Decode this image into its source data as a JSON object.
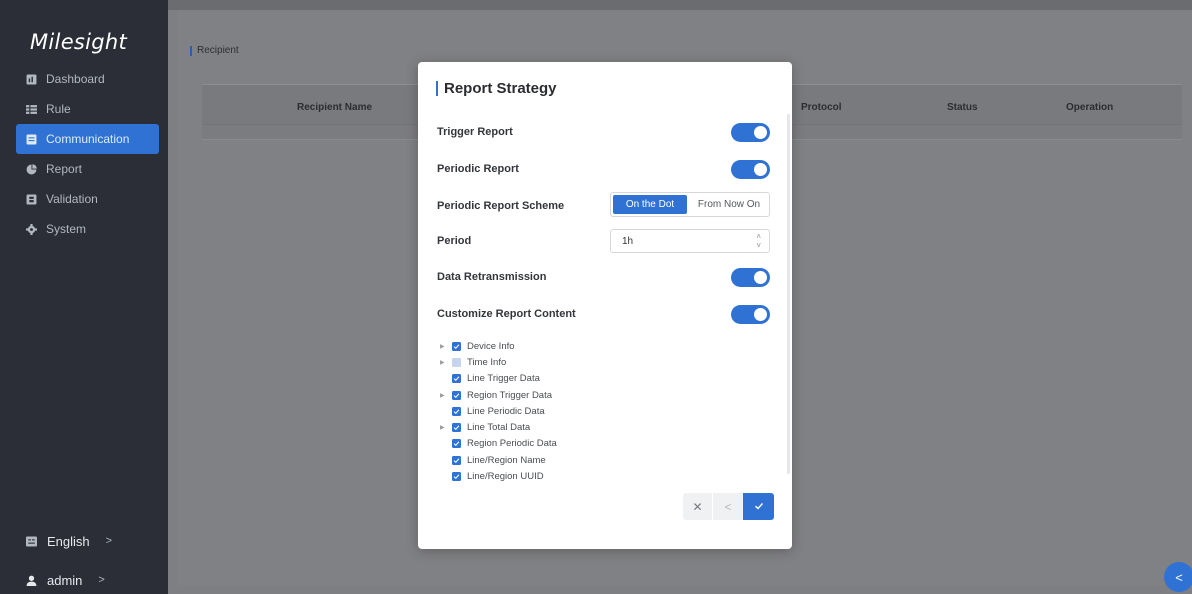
{
  "sidebar": {
    "brand": "Milesight",
    "items": [
      {
        "label": "Dashboard"
      },
      {
        "label": "Rule"
      },
      {
        "label": "Communication"
      },
      {
        "label": "Report"
      },
      {
        "label": "Validation"
      },
      {
        "label": "System"
      }
    ],
    "language": "English",
    "user": "admin"
  },
  "page": {
    "breadcrumb": "Recipient",
    "columns": [
      "Recipient Name",
      "Protocol",
      "Status",
      "Operation"
    ]
  },
  "modal": {
    "title": "Report Strategy",
    "trigger_report": {
      "label": "Trigger Report",
      "enabled": true
    },
    "periodic_report": {
      "label": "Periodic Report",
      "enabled": true
    },
    "scheme": {
      "label": "Periodic Report Scheme",
      "options": [
        "On the Dot",
        "From Now On"
      ],
      "selected": "On the Dot"
    },
    "period": {
      "label": "Period",
      "value": "1h"
    },
    "data_retransmission": {
      "label": "Data Retransmission",
      "enabled": true
    },
    "customize": {
      "label": "Customize Report Content",
      "enabled": true
    },
    "content_items": [
      {
        "label": "Device Info",
        "expandable": true,
        "state": "checked"
      },
      {
        "label": "Time Info",
        "expandable": true,
        "state": "partial"
      },
      {
        "label": "Line Trigger Data",
        "expandable": false,
        "state": "checked"
      },
      {
        "label": "Region Trigger Data",
        "expandable": true,
        "state": "checked"
      },
      {
        "label": "Line Periodic Data",
        "expandable": false,
        "state": "checked"
      },
      {
        "label": "Line Total Data",
        "expandable": true,
        "state": "checked"
      },
      {
        "label": "Region Periodic Data",
        "expandable": false,
        "state": "checked"
      },
      {
        "label": "Line/Region Name",
        "expandable": false,
        "state": "checked"
      },
      {
        "label": "Line/Region UUID",
        "expandable": false,
        "state": "checked"
      }
    ]
  },
  "colors": {
    "accent": "#2f72d3",
    "sidebar": "#2b2e36"
  }
}
